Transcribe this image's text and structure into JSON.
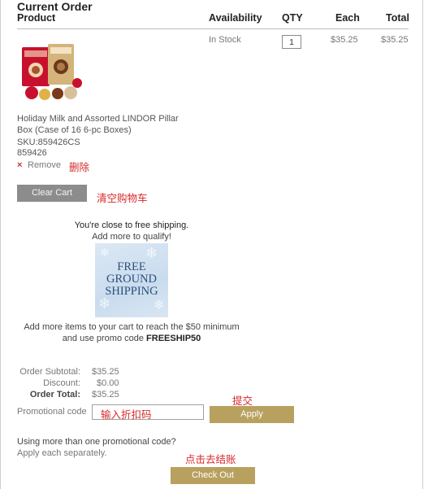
{
  "cart": {
    "title": "Current Order",
    "headers": {
      "product": "Product",
      "availability": "Availability",
      "qty": "QTY",
      "each": "Each",
      "total": "Total"
    },
    "item": {
      "name": "Holiday Milk and Assorted LINDOR Pillar Box (Case of 16 6-pc Boxes)",
      "sku": "SKU:859426CS",
      "code": "859426",
      "availability": "In Stock",
      "qty": "1",
      "each": "$35.25",
      "total": "$35.25",
      "remove_icon": "×",
      "remove_label": "Remove"
    },
    "clear_cart_label": "Clear Cart"
  },
  "shipping": {
    "line1": "You're close to free shipping.",
    "line2": "Add more to qualify!",
    "banner_text": "FREE GROUND SHIPPING",
    "promo_line1": "Add more items to your cart to reach the $50 minimum",
    "promo_line2_prefix": "and use promo code ",
    "promo_code": "FREESHIP50"
  },
  "summary": {
    "subtotal_label": "Order Subtotal:",
    "subtotal_value": "$35.25",
    "discount_label": "Discount:",
    "discount_value": "$0.00",
    "total_label": "Order Total:",
    "total_value": "$35.25"
  },
  "promo": {
    "label": "Promotional code",
    "value": "",
    "apply_label": "Apply",
    "multi_line1": "Using more than one promotional code?",
    "multi_line2": "Apply each separately."
  },
  "checkout_label": "Check Out",
  "annotations": {
    "delete": "删除",
    "clear": "清空购物车",
    "submit": "提交",
    "promo": "输入折扣码",
    "checkout": "点击去结账"
  }
}
